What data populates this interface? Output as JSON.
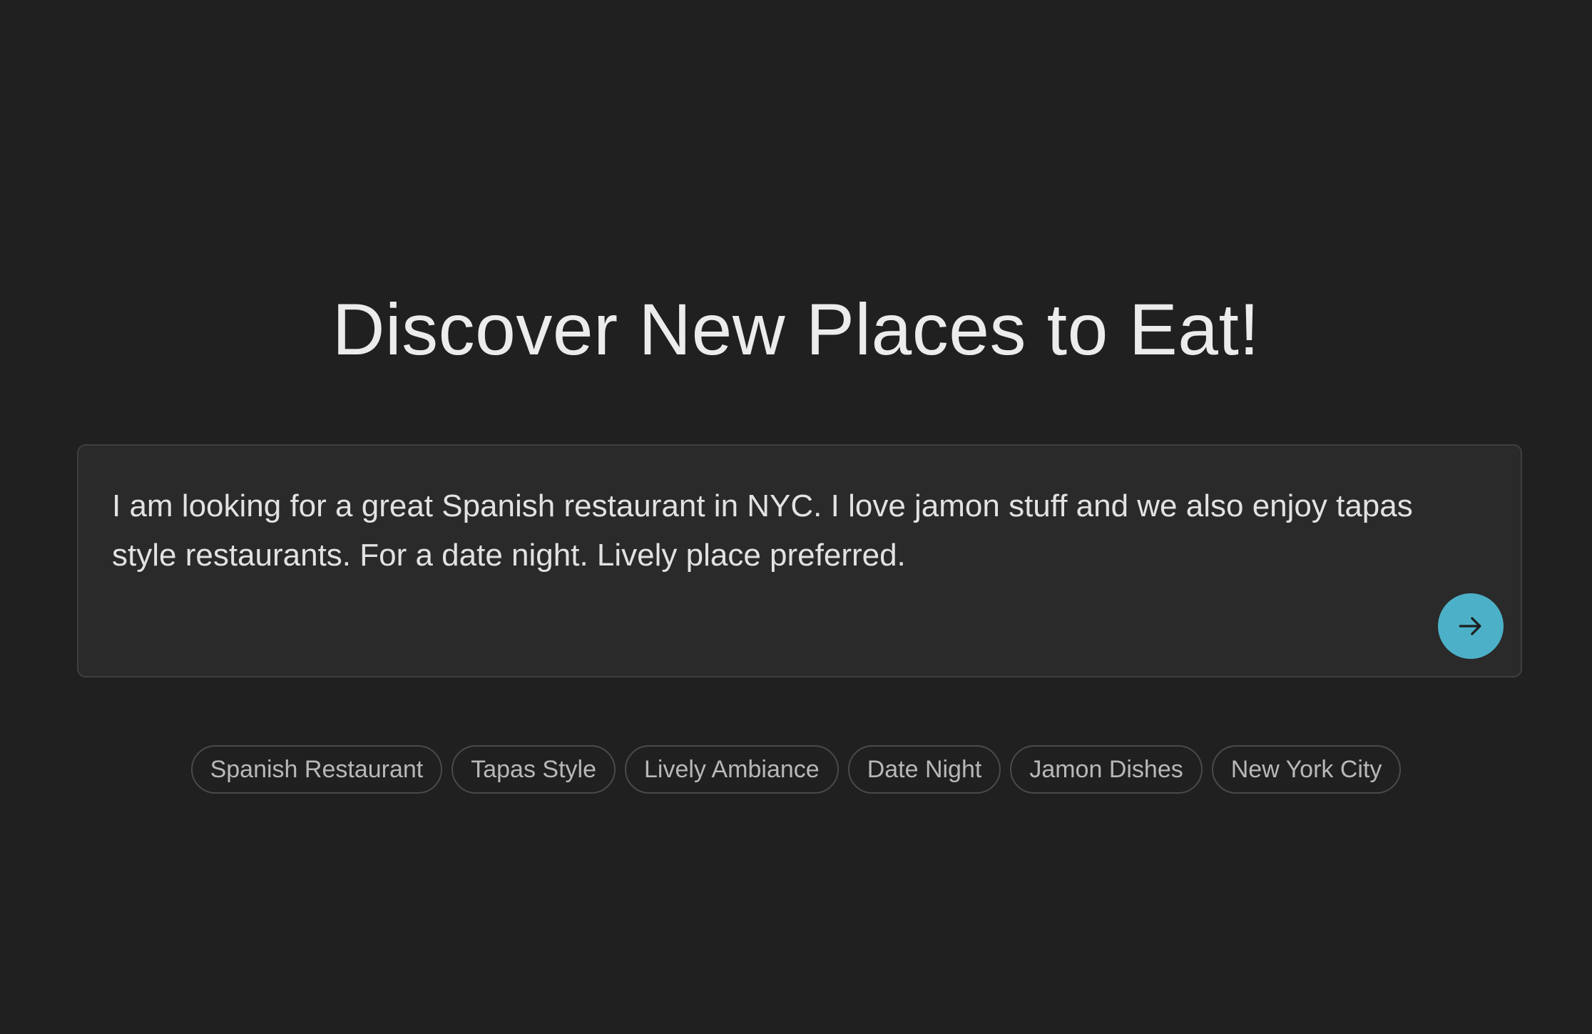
{
  "header": {
    "title": "Discover New Places to Eat!"
  },
  "search": {
    "value": "I am looking for a great Spanish restaurant in NYC. I love jamon stuff and we also enjoy tapas style restaurants. For a date night. Lively place preferred.",
    "submit_icon": "arrow-right-icon"
  },
  "tags": [
    "Spanish Restaurant",
    "Tapas Style",
    "Lively Ambiance",
    "Date Night",
    "Jamon Dishes",
    "New York City"
  ],
  "colors": {
    "background": "#202020",
    "panel": "#2a2a2a",
    "accent": "#4cb1c8"
  }
}
